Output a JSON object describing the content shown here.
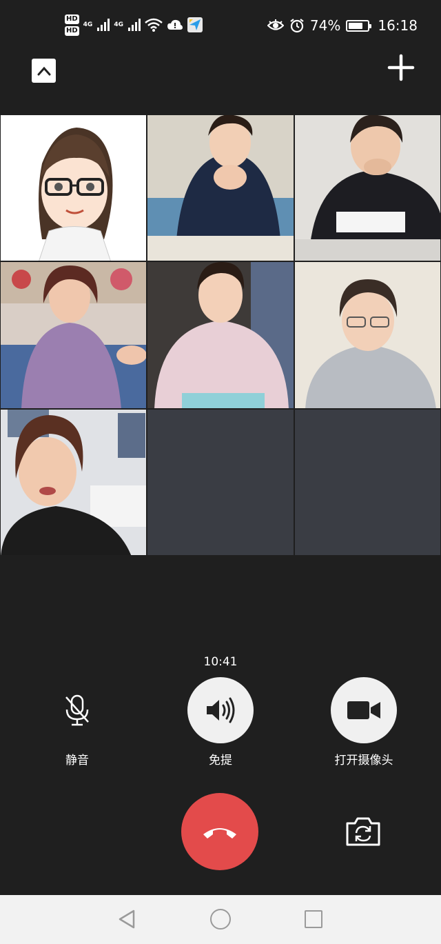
{
  "status_bar": {
    "sim1_badge": "HD",
    "sim2_badge": "HD",
    "net1": "4G",
    "net2": "4G",
    "battery_percent": "74%",
    "battery_level": 0.74,
    "time": "16:18",
    "icons": [
      "signal-icon",
      "wifi-icon",
      "cloud-icon",
      "app-icon",
      "eye-comfort-icon",
      "alarm-icon",
      "battery-icon"
    ]
  },
  "call": {
    "duration": "10:41",
    "participants_visible": 7,
    "controls": {
      "mute_label": "静音",
      "speaker_label": "免提",
      "camera_label": "打开摄像头"
    }
  },
  "colors": {
    "background": "#1f1f1f",
    "empty_tile": "#3a3d44",
    "hangup": "#e34b4b",
    "control_button": "#f0f0f0",
    "nav_bar": "#f2f2f2"
  }
}
